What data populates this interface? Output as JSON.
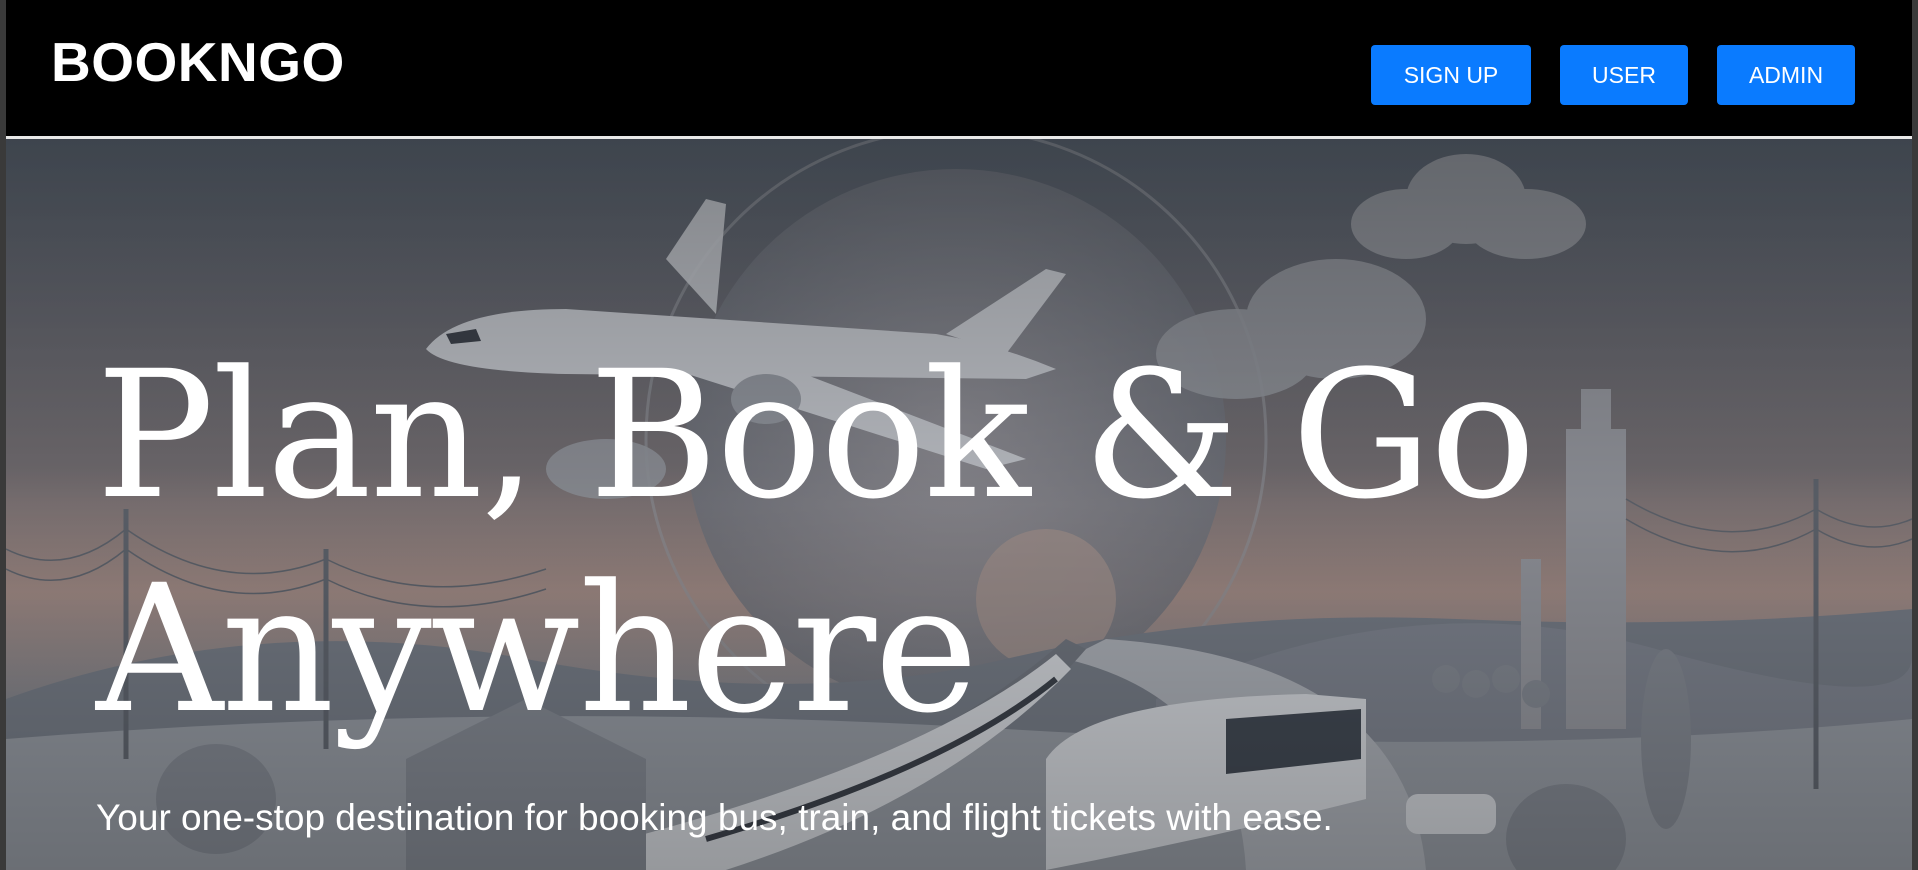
{
  "brand": {
    "name": "BOOKNGO"
  },
  "nav": {
    "signup_label": "SIGN UP",
    "user_label": "USER",
    "admin_label": "ADMIN"
  },
  "hero": {
    "title": "Plan, Book & Go Anywhere",
    "subtitle": "Your one-stop destination for booking bus, train, and flight tickets with ease."
  },
  "colors": {
    "accent": "#0a7bff",
    "navbar_bg": "#000000",
    "hero_text": "#ffffff"
  }
}
